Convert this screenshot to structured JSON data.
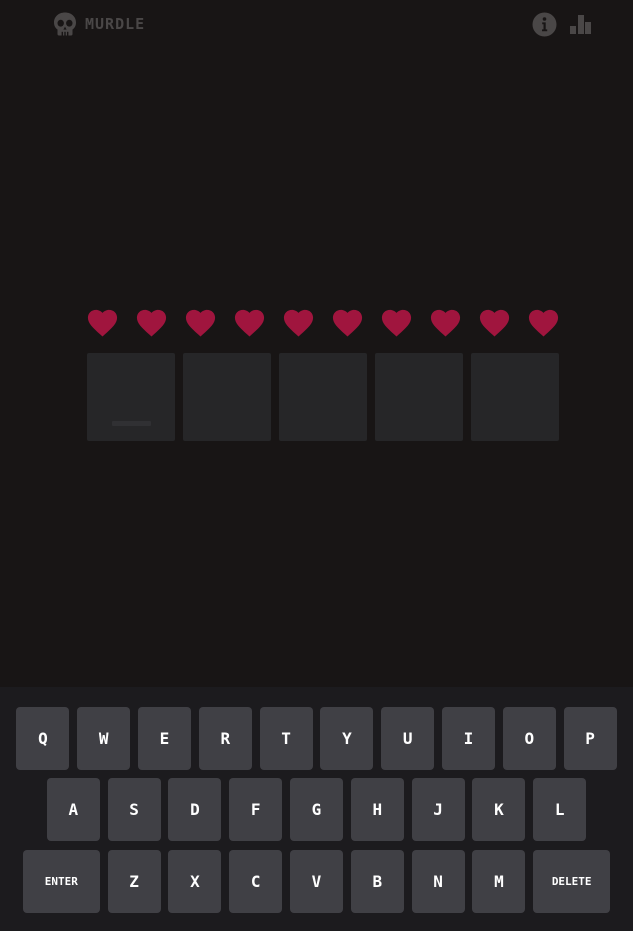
{
  "app": {
    "title": "MURDLE"
  },
  "header": {
    "info_icon": "info-circle-icon",
    "stats_icon": "bar-chart-icon"
  },
  "lives": {
    "remaining": 10,
    "total": 10,
    "heart_color": "#a0153e"
  },
  "board": {
    "letters": [
      "",
      "",
      "",
      "",
      ""
    ],
    "active_index": 0
  },
  "keyboard": {
    "rows": [
      [
        "Q",
        "W",
        "E",
        "R",
        "T",
        "Y",
        "U",
        "I",
        "O",
        "P"
      ],
      [
        "A",
        "S",
        "D",
        "F",
        "G",
        "H",
        "J",
        "K",
        "L"
      ],
      [
        "ENTER",
        "Z",
        "X",
        "C",
        "V",
        "B",
        "N",
        "M",
        "DELETE"
      ]
    ]
  },
  "colors": {
    "background": "#181515",
    "tile": "#262628",
    "key": "#404045",
    "keyboard_bg": "#1c1b1e",
    "muted": "#4a4747"
  }
}
